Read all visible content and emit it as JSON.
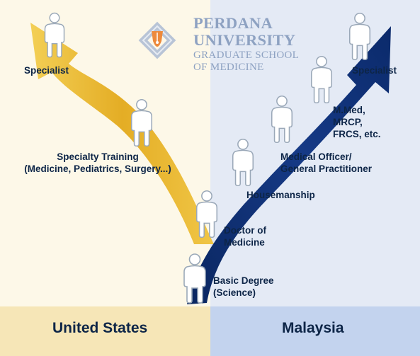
{
  "logo": {
    "name_line1": "PERDANA",
    "name_line2": "UNIVERSITY",
    "sub_line1": "GRADUATE SCHOOL",
    "sub_line2": "OF MEDICINE"
  },
  "footer": {
    "left_label": "United States",
    "right_label": "Malaysia"
  },
  "us_path": {
    "specialist": "Specialist",
    "specialty_training": "Specialty Training\n(Medicine, Pediatrics, Surgery...)"
  },
  "shared_path": {
    "basic_degree": "Basic Degree\n(Science)",
    "doctor_of_medicine": "Doctor of\nMedicine"
  },
  "malaysia_path": {
    "housemanship": "Housemanship",
    "medical_officer": "Medical Officer/\nGeneral Practitioner",
    "postgrad": "M.Med,\nMRCP,\nFRCS, etc.",
    "specialist": "Specialist"
  },
  "colors": {
    "us_background": "#fdf8e8",
    "my_background": "#e4eaf5",
    "us_footer": "#f6e6b7",
    "my_footer": "#c3d3ee",
    "gold_arrow": "#e9b52c",
    "blue_arrow": "#0c2a66",
    "person_fill": "#ffffff",
    "person_stroke": "#9aa8b8",
    "label_text": "#0d2547",
    "logo_text": "#8ea2c2"
  },
  "icons": [
    "person-icon",
    "pen-nib-icon"
  ]
}
